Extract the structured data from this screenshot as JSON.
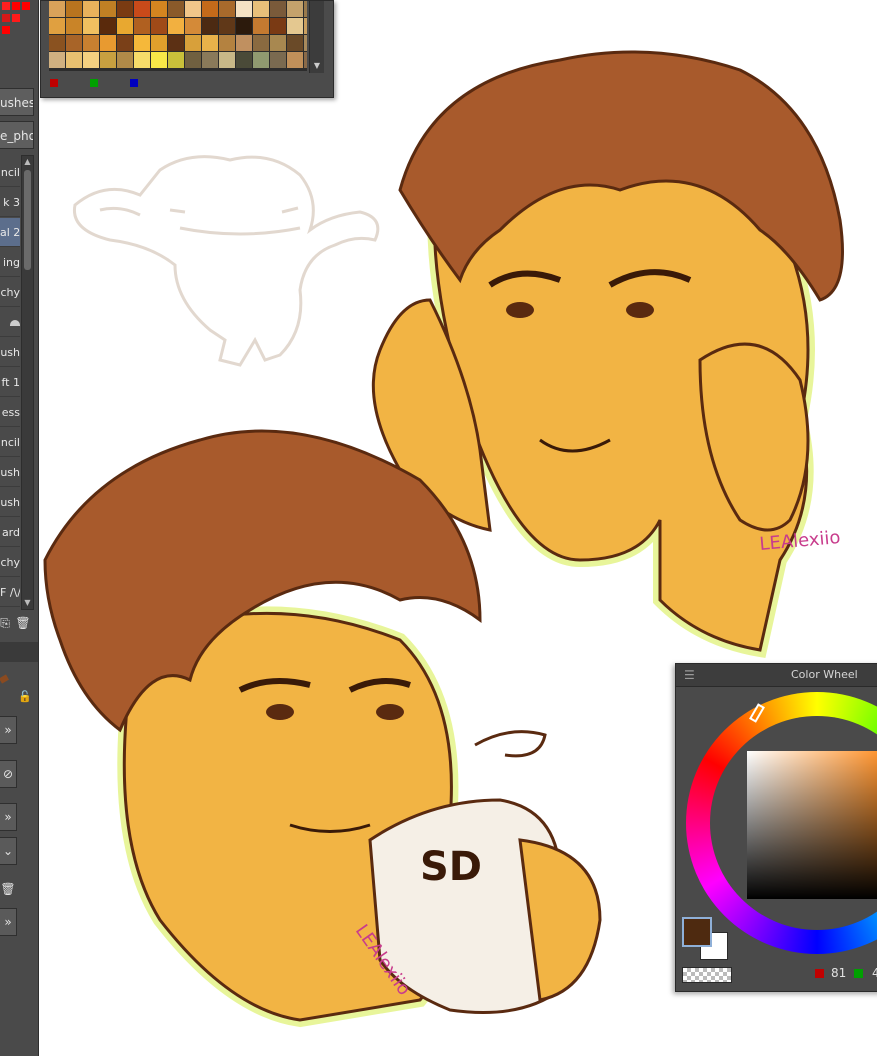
{
  "left_panel": {
    "tabs": [
      "ushes",
      "e_pho"
    ],
    "brush_items": [
      "ncil",
      "k 3",
      "al 2",
      "ing",
      "chy",
      "",
      "ush",
      "ft 1",
      "ess",
      "ncil",
      "ush",
      "ush",
      "ard",
      "chy",
      "F /\\/"
    ],
    "selected_index": 2
  },
  "palette": {
    "colors": [
      "#d9a25a",
      "#b8741f",
      "#e8b25c",
      "#c08024",
      "#7a3b12",
      "#c94a1a",
      "#d48520",
      "#8a5a2a",
      "#f1c68a",
      "#c46a1a",
      "#a86a2c",
      "#f4e2c4",
      "#e8c07a",
      "#7a5a3a",
      "#c4a26c",
      "#9a7a4c",
      "#e0a040",
      "#c98428",
      "#f0c060",
      "#5a2a0c",
      "#e8a830",
      "#b06020",
      "#a04a18",
      "#f2b040",
      "#d48a38",
      "#4c2a12",
      "#603818",
      "#2c1a0c",
      "#c47a30",
      "#7a3a14",
      "#e4c890",
      "#caa060",
      "#8a5220",
      "#a86428",
      "#c88030",
      "#e89a30",
      "#7a4018",
      "#f5b83a",
      "#e0a02c",
      "#5c3014",
      "#d8a03a",
      "#e8b24a",
      "#b48240",
      "#c09060",
      "#8a6a40",
      "#a88850",
      "#6a4a28",
      "#a88a5c",
      "#d0b080",
      "#e8c070",
      "#f4d080",
      "#c8a040",
      "#b08a48",
      "#f6dc6a",
      "#f8e848",
      "#c9c03a",
      "#706040",
      "#8a7a5a",
      "#c8b888",
      "#4a4a38",
      "#909a70",
      "#7a6a50",
      "#c0905a",
      "#8a6a48"
    ],
    "rgb": {
      "r_color": "#c00000",
      "g_color": "#00a000",
      "b_color": "#0000c0"
    }
  },
  "color_wheel": {
    "title": "Color Wheel",
    "current_color": "#4e2a10",
    "secondary_color": "#ffffff",
    "values": {
      "r": "81",
      "g": "4"
    }
  },
  "signatures": {
    "top": "LEAlexiio",
    "bottom": "LEAlexiio"
  },
  "mug_logo": "SD"
}
